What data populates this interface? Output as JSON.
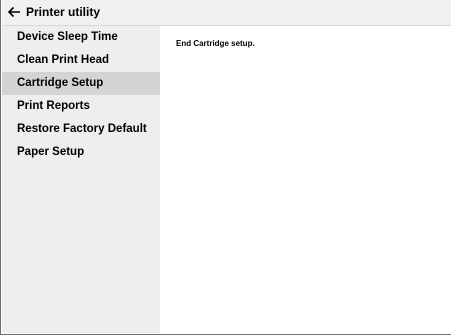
{
  "header": {
    "title": "Printer utility",
    "back_icon": "arrow-left-icon"
  },
  "sidebar": {
    "items": [
      {
        "label": "Device Sleep Time"
      },
      {
        "label": "Clean Print Head"
      },
      {
        "label": "Cartridge Setup",
        "selected": true
      },
      {
        "label": "Print Reports"
      },
      {
        "label": "Restore Factory Default"
      },
      {
        "label": "Paper Setup"
      }
    ]
  },
  "main": {
    "message": "End Cartridge setup."
  },
  "colors": {
    "sidebar_bg": "#eeeeee",
    "selected_bg": "#d4d4d4",
    "titlebar_bg": "#f0f0f0"
  }
}
